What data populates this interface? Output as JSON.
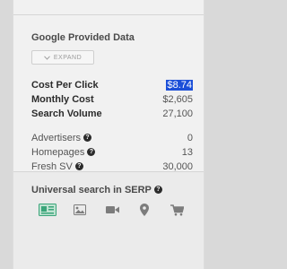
{
  "google_provided": {
    "title": "Google Provided Data",
    "expand_label": "EXPAND"
  },
  "metrics_primary": [
    {
      "label": "Cost Per Click",
      "value": "$8.74",
      "highlighted": true
    },
    {
      "label": "Monthly Cost",
      "value": "$2,605"
    },
    {
      "label": "Search Volume",
      "value": "27,100"
    }
  ],
  "metrics_secondary": [
    {
      "label": "Advertisers",
      "value": "0",
      "help": true
    },
    {
      "label": "Homepages",
      "value": "13",
      "help": true
    },
    {
      "label": "Fresh SV",
      "value": "30,000",
      "help": true
    }
  ],
  "serp": {
    "title": "Universal search in SERP",
    "icons": [
      "news-icon",
      "image-icon",
      "video-icon",
      "map-pin-icon",
      "shopping-cart-icon"
    ],
    "active_icon": "news-icon",
    "active_color": "#3aa57a",
    "inactive_color": "#7c7c7c"
  },
  "colors": {
    "highlight": "#1b4fd8"
  }
}
